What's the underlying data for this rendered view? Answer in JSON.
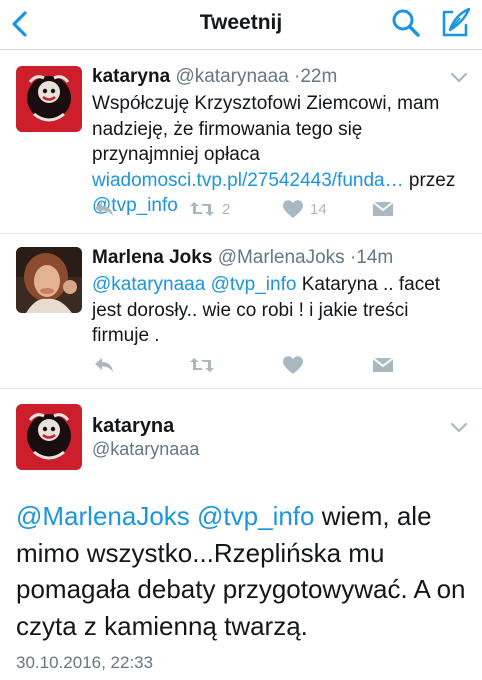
{
  "header": {
    "title": "Tweetnij",
    "back_icon": "chevron-left-icon",
    "search_icon": "search-icon",
    "compose_icon": "compose-icon",
    "accent_color": "#1b95e0"
  },
  "tweets": [
    {
      "name": "kataryna",
      "handle": "@katarynaaa",
      "separator": "·",
      "time": "22m",
      "text_plain_1": "Współczuję Krzysztofowi Ziemcowi, mam nadzieję, że firmowania tego się przynajmniej opłaca ",
      "link_1": "wiadomosci.tvp.pl/27542443/funda…",
      "text_plain_2": " przez ",
      "link_2": "@tvp_info",
      "reply_count": "",
      "retweet_count": "2",
      "like_count": "14"
    },
    {
      "name": "Marlena Joks",
      "handle": "@MarlenaJoks",
      "separator": "·",
      "time": "14m",
      "link_1": "@katarynaaa",
      "text_plain_1": " ",
      "link_2": "@tvp_info",
      "text_plain_2": " Kataryna .. facet jest dorosły.. wie co robi ! i jakie treści firmuje ."
    }
  ],
  "focused": {
    "name": "kataryna",
    "handle": "@katarynaaa",
    "link_1": "@MarlenaJoks",
    "text_plain_1": " ",
    "link_2": "@tvp_info",
    "text_plain_2": " wiem, ale mimo wszystko...Rzeplińska mu pomagała debaty przygotowywać. A on czyta z kamienną twarzą.",
    "date": "30.10.2016, 22:33"
  }
}
